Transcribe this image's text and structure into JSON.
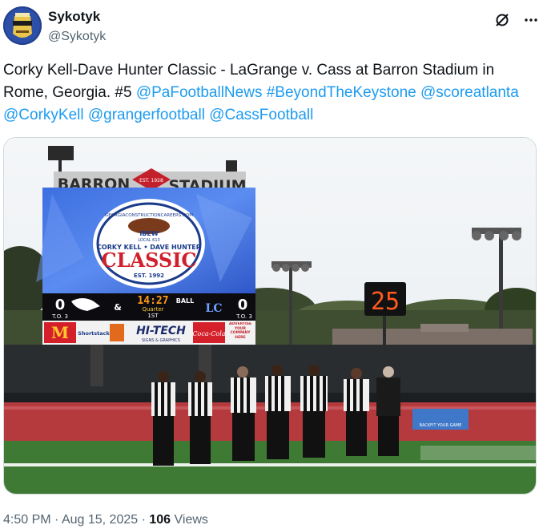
{
  "author": {
    "display_name": "Sykotyk",
    "handle": "@Sykotyk"
  },
  "header_icons": [
    "grok-icon",
    "more-icon"
  ],
  "tweet": {
    "text_plain": "Corky Kell-Dave Hunter Classic - LaGrange v. Cass at Barron Stadium in Rome, Georgia. #5 ",
    "links": [
      "@PaFootballNews",
      "#BeyondTheKeystone",
      "@scoreatlanta",
      "@CorkyKell",
      "@grangerfootball",
      "@CassFootball"
    ]
  },
  "photo": {
    "stadium_sign_left": "BARRON",
    "stadium_sign_center": "EST. 1928",
    "stadium_sign_right": "STADIUM",
    "sponsor_top": "GEORGIACONSTRUCTIONCAREERS.COM",
    "ibew": "IBEW",
    "local": "LOCAL 613",
    "event_line1": "CORKY KELL • DAVE HUNTER",
    "event_line2": "CLASSIC",
    "event_est": "EST. 1992",
    "home_score": "0",
    "home_to": "T.O. 3",
    "away_score": "0",
    "away_to": "T.O. 3",
    "ball_on": "&",
    "clock": "14:27",
    "quarter_label": "Quarter",
    "quarter": "1ST",
    "ball_label": "BALL",
    "away_logo": "LC",
    "playclock": "25",
    "ad_hitech": "HI-TECH",
    "ad_hitech_sub": "SIGNS & GRAPHICS",
    "ad_coke": "Coca-Cola",
    "ad_advertise": "ADVERTISE YOUR COMPANY HERE",
    "ad_shortstack": "Shortstack",
    "field_banner": "BACKFIT YOUR GAME"
  },
  "meta": {
    "time": "4:50 PM",
    "sep1": " · ",
    "date": "Aug 15, 2025",
    "sep2": " · ",
    "views_count": "106",
    "views_label": " Views"
  },
  "colors": {
    "link": "#1d9bf0",
    "secondary_text": "#536471",
    "primary_text": "#0f1419"
  }
}
